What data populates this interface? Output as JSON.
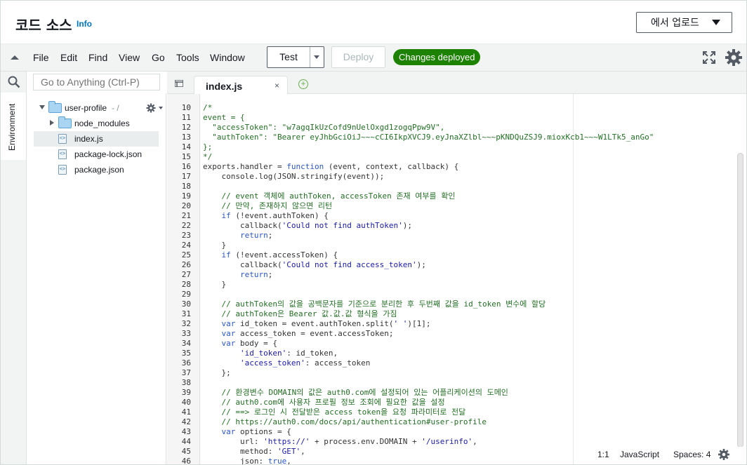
{
  "header": {
    "title": "코드 소스",
    "info": "Info",
    "upload_label": "에서 업로드"
  },
  "menubar": {
    "items": [
      "File",
      "Edit",
      "Find",
      "View",
      "Go",
      "Tools",
      "Window"
    ],
    "test_label": "Test",
    "deploy_label": "Deploy",
    "status_badge": "Changes deployed"
  },
  "sidebar": {
    "rail_tab": "Environment",
    "goto_placeholder": "Go to Anything (Ctrl-P)",
    "root": {
      "label": "user-profile",
      "suffix": "- /"
    },
    "items": [
      {
        "label": "node_modules",
        "type": "folder"
      },
      {
        "label": "index.js",
        "type": "file",
        "selected": true
      },
      {
        "label": "package-lock.json",
        "type": "file"
      },
      {
        "label": "package.json",
        "type": "file"
      }
    ]
  },
  "editor": {
    "tab_label": "index.js",
    "tab_close": "×",
    "lines": [
      {
        "n": "10",
        "t": "/*",
        "k": "c"
      },
      {
        "n": "11",
        "t": "event = {",
        "k": "c"
      },
      {
        "n": "12",
        "t": "  \"accessToken\": \"w7agqIkUzCofd9nUelOxgd1zogqPpw9V\",",
        "k": "c"
      },
      {
        "n": "13",
        "t": "  \"authToken\": \"Bearer eyJhbGciOiJ~~~cCI6IkpXVCJ9.eyJnaXZlbl~~~pKNDQuZSJ9.mioxKcb1~~~W1LTk5_anGo\"",
        "k": "c"
      },
      {
        "n": "14",
        "t": "};",
        "k": "c"
      },
      {
        "n": "15",
        "t": "*/",
        "k": "c"
      },
      {
        "n": "16",
        "t": "exports.handler = function (event, context, callback) {",
        "k": "fn"
      },
      {
        "n": "17",
        "t": "    console.log(JSON.stringify(event));",
        "k": "log"
      },
      {
        "n": "18",
        "t": "",
        "k": ""
      },
      {
        "n": "19",
        "t": "    // event 객체에 authToken, accessToken 존재 여부를 확인",
        "k": "c"
      },
      {
        "n": "20",
        "t": "    // 만약, 존재하지 않으면 리턴",
        "k": "c"
      },
      {
        "n": "21",
        "t": "    if (!event.authToken) {",
        "k": "if"
      },
      {
        "n": "22",
        "t": "        callback('Could not find authToken');",
        "k": "cb"
      },
      {
        "n": "23",
        "t": "        return;",
        "k": "ret"
      },
      {
        "n": "24",
        "t": "    }",
        "k": ""
      },
      {
        "n": "25",
        "t": "    if (!event.accessToken) {",
        "k": "if"
      },
      {
        "n": "26",
        "t": "        callback('Could not find access_token');",
        "k": "cb"
      },
      {
        "n": "27",
        "t": "        return;",
        "k": "ret"
      },
      {
        "n": "28",
        "t": "    }",
        "k": ""
      },
      {
        "n": "29",
        "t": "",
        "k": ""
      },
      {
        "n": "30",
        "t": "    // authToken의 값을 공백문자를 기준으로 분리한 후 두번째 값을 id_token 변수에 할당",
        "k": "c"
      },
      {
        "n": "31",
        "t": "    // authToken은 Bearer 값.값.값 형식을 가짐",
        "k": "c"
      },
      {
        "n": "32",
        "t": "    var id_token = event.authToken.split(' ')[1];",
        "k": "var"
      },
      {
        "n": "33",
        "t": "    var access_token = event.accessToken;",
        "k": "var"
      },
      {
        "n": "34",
        "t": "    var body = {",
        "k": "var"
      },
      {
        "n": "35",
        "t": "        'id_token': id_token,",
        "k": "prop"
      },
      {
        "n": "36",
        "t": "        'access_token': access_token",
        "k": "prop"
      },
      {
        "n": "37",
        "t": "    };",
        "k": ""
      },
      {
        "n": "38",
        "t": "",
        "k": ""
      },
      {
        "n": "39",
        "t": "    // 환경변수 DOMAIN의 값은 auth0.com에 설정되어 있는 어플리케이션의 도메인",
        "k": "c"
      },
      {
        "n": "40",
        "t": "    // auth0.com에 사용자 프로필 정보 조회에 필요한 값을 설정",
        "k": "c"
      },
      {
        "n": "41",
        "t": "    // ==> 로그인 시 전달받은 access token을 요청 파라미터로 전달",
        "k": "c"
      },
      {
        "n": "42",
        "t": "    // https://auth0.com/docs/api/authentication#user-profile",
        "k": "c"
      },
      {
        "n": "43",
        "t": "    var options = {",
        "k": "var"
      },
      {
        "n": "44",
        "t": "        url: 'https://' + process.env.DOMAIN + '/userinfo',",
        "k": "url"
      },
      {
        "n": "45",
        "t": "        method: 'GET',",
        "k": "method"
      },
      {
        "n": "46",
        "t": "        json: true,",
        "k": "json"
      }
    ]
  },
  "statusbar": {
    "position": "1:1",
    "language": "JavaScript",
    "indent": "Spaces: 4"
  }
}
